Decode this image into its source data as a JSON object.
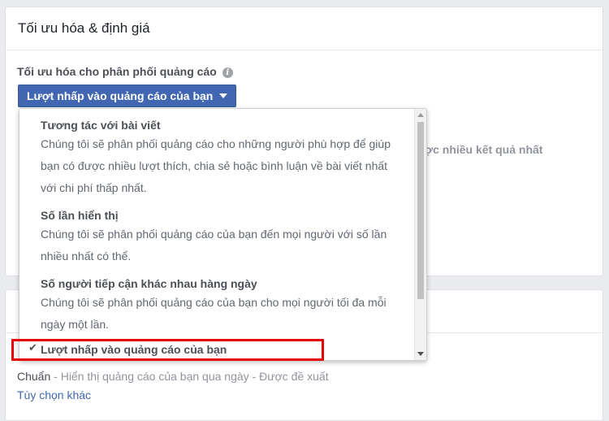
{
  "card": {
    "title": "Tối ưu hóa & định giá",
    "opt_label": "Tối ưu hóa cho phân phối quảng cáo",
    "info_icon": "i",
    "dropdown_value": "Lượt nhấp vào quảng cáo của bạn",
    "behind_text": "ược nhiều kết quả nhất"
  },
  "menu": {
    "items": [
      {
        "title": "Tương tác với bài viết",
        "desc": "Chúng tôi sẽ phân phối quảng cáo cho những người phù hợp để giúp bạn có được nhiều lượt thích, chia sẻ hoặc bình luận về bài viết nhất với chi phí thấp nhất."
      },
      {
        "title": "Số lần hiển thị",
        "desc": "Chúng tôi sẽ phân phối quảng cáo của bạn đến mọi người với số lần nhiều nhất có thể."
      },
      {
        "title": "Số người tiếp cận khác nhau hàng ngày",
        "desc": "Chúng tôi sẽ phân phối quảng cáo của bạn cho mọi người tối đa mỗi ngày một lần."
      }
    ],
    "selected": {
      "check": "✔",
      "title": "Lượt nhấp vào quảng cáo của bạn"
    }
  },
  "delivery": {
    "type": "Chuẩn",
    "desc": " - Hiển thị quảng cáo của bạn qua ngày - Được đề xuất",
    "more_link": "Tùy chọn khác"
  },
  "colors": {
    "accent": "#4267b2",
    "highlight": "#e60000"
  }
}
